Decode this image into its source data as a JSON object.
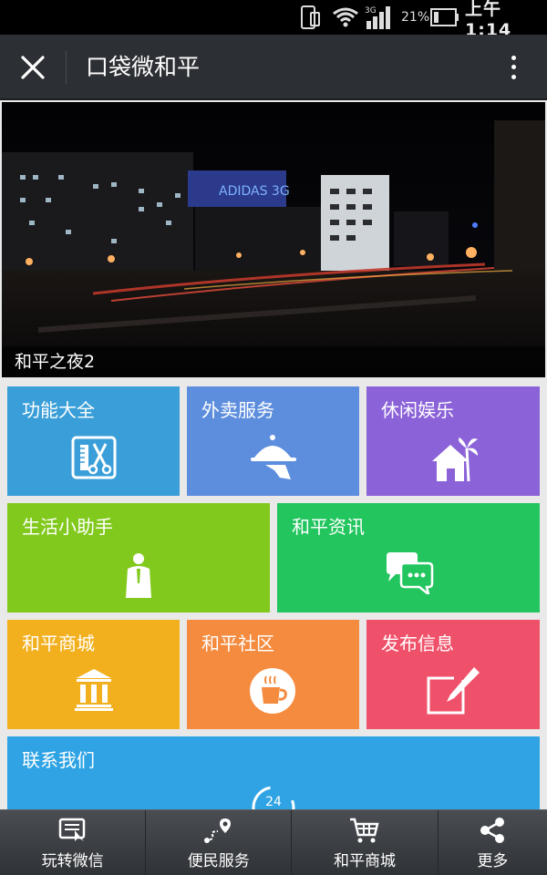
{
  "status_bar": {
    "battery_percent": "21%",
    "time": "上午 1:14"
  },
  "header": {
    "title": "口袋微和平"
  },
  "banner": {
    "caption": "和平之夜2"
  },
  "tiles": [
    {
      "label": "功能大全",
      "color": "#3a9fd8",
      "icon": "tools-icon"
    },
    {
      "label": "外卖服务",
      "color": "#5d8ede",
      "icon": "food-delivery-icon"
    },
    {
      "label": "休闲娱乐",
      "color": "#8b62d8",
      "icon": "house-palm-icon"
    },
    {
      "label": "生活小助手",
      "color": "#82c91e",
      "icon": "person-suit-icon"
    },
    {
      "label": "和平资讯",
      "color": "#22c55e",
      "icon": "chat-bubbles-icon"
    },
    {
      "label": "和平商城",
      "color": "#f2b01e",
      "icon": "bank-building-icon"
    },
    {
      "label": "和平社区",
      "color": "#f58b3f",
      "icon": "coffee-cup-icon"
    },
    {
      "label": "发布信息",
      "color": "#f0516a",
      "icon": "edit-pencil-icon"
    },
    {
      "label": "联系我们",
      "color": "#2fa3e4",
      "icon": "clock-24-icon",
      "badge": "24"
    }
  ],
  "bottom_nav": [
    {
      "label": "玩转微信",
      "icon": "wechat-book-icon"
    },
    {
      "label": "便民服务",
      "icon": "location-route-icon"
    },
    {
      "label": "和平商城",
      "icon": "shopping-cart-icon"
    },
    {
      "label": "更多",
      "icon": "share-icon"
    }
  ]
}
